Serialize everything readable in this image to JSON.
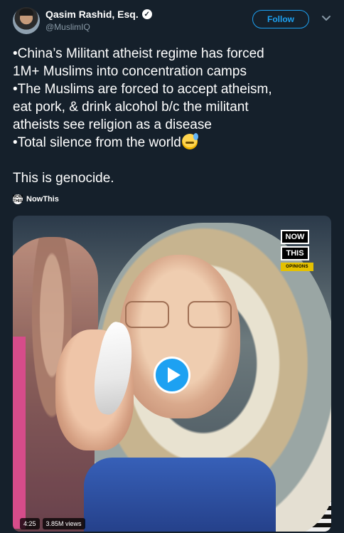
{
  "header": {
    "author_name": "Qasim Rashid, Esq.",
    "verified_glyph": "✓",
    "handle": "@MuslimIQ",
    "follow_label": "Follow"
  },
  "tweet": {
    "lines": [
      "•China’s Militant atheist regime has forced",
      "1M+ Muslims into concentration camps",
      "•The Muslims are forced to accept atheism,",
      "eat pork, & drink alcohol b/c the militant",
      "atheists see religion as a disease",
      "•Total silence from the world"
    ],
    "emoji": "downcast-face-with-sweat",
    "closing": "This is genocide."
  },
  "source": {
    "label": "NowThis"
  },
  "video": {
    "logo_line1": "NOW",
    "logo_line2": "THIS",
    "logo_tag": "OPINIONS",
    "duration": "4:25",
    "views": "3.85M views"
  },
  "colors": {
    "background": "#15202b",
    "accent": "#1da1f2",
    "secondary_text": "#8899a6",
    "opinions_yellow": "#e5c100"
  }
}
